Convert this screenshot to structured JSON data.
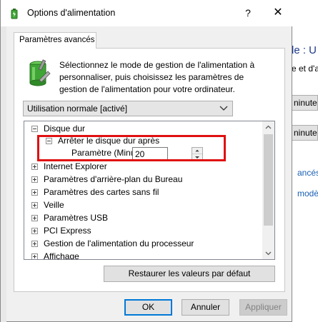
{
  "background_window": {
    "heading": "le : U",
    "line": "e et d'a",
    "buttons": [
      "ninutes",
      "ninutes"
    ],
    "links": [
      "ancés",
      "modè"
    ]
  },
  "dialog": {
    "title": "Options d'alimentation",
    "help_label": "?",
    "close_label": "✕",
    "tab_label": "Paramètres avancés",
    "intro_text": "Sélectionnez le mode de gestion de l'alimentation à personnaliser, puis choisissez les paramètres de gestion de l'alimentation pour votre ordinateur.",
    "plan_select": {
      "selected": "Utilisation normale [activé]"
    },
    "tree": {
      "disque_dur": "Disque dur",
      "arreter_disque": "Arrêter le disque dur après",
      "parametre_label": "Paramètre (Minutes) :",
      "parametre_value": "20",
      "items": [
        "Internet Explorer",
        "Paramètres d'arrière-plan du Bureau",
        "Paramètres des cartes sans fil",
        "Veille",
        "Paramètres USB",
        "PCI Express",
        "Gestion de l'alimentation du processeur",
        "Affichage"
      ]
    },
    "restore_label": "Restaurer les valeurs par défaut",
    "ok_label": "OK",
    "cancel_label": "Annuler",
    "apply_label": "Appliquer"
  },
  "colors": {
    "highlight": "#e01010",
    "accent": "#0078d7",
    "battery_green": "#3fa535"
  },
  "icons": [
    "battery-settings-icon",
    "chevron-down-icon",
    "expander-minus-icon",
    "expander-plus-icon",
    "spin-up-icon",
    "spin-down-icon",
    "scroll-up-icon",
    "scroll-down-icon"
  ]
}
